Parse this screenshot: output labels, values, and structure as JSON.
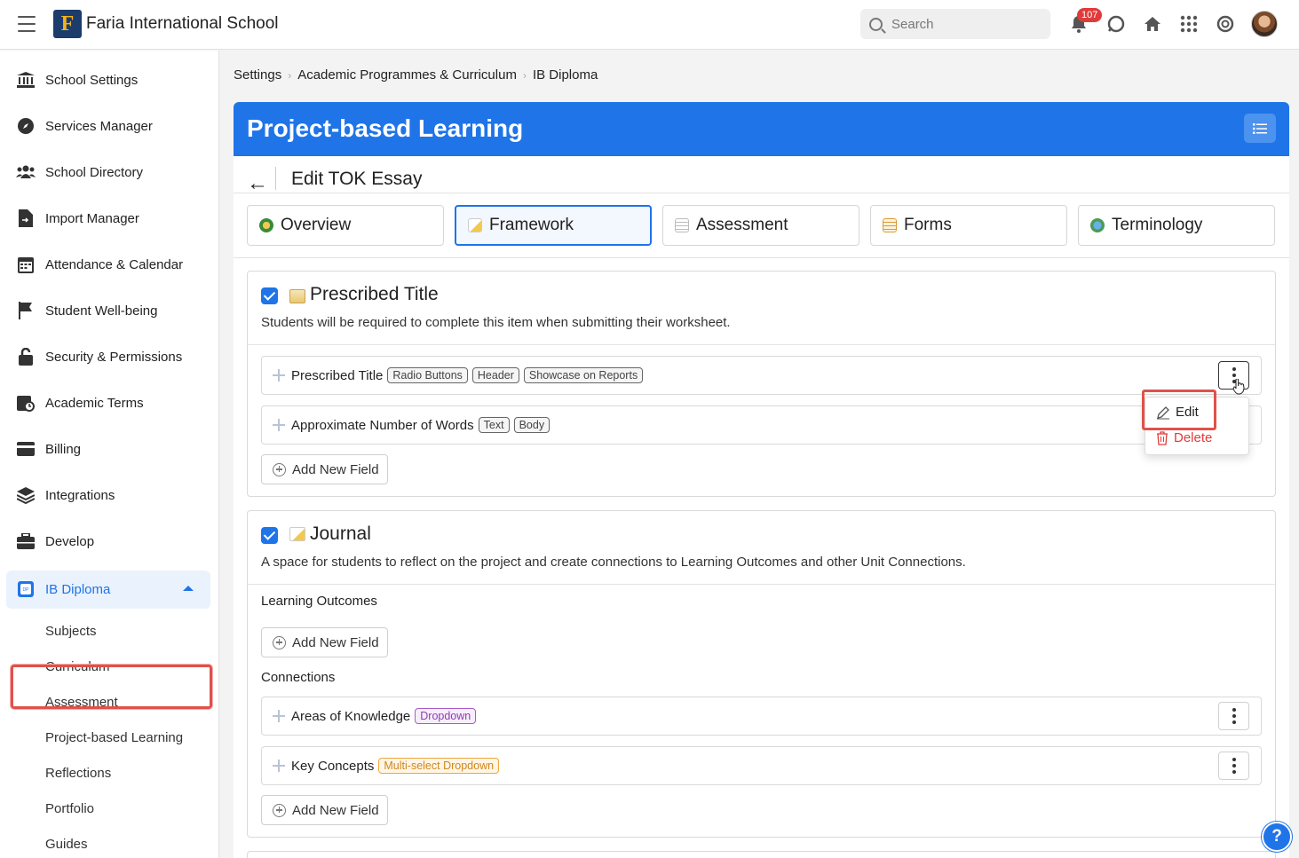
{
  "topbar": {
    "school_name": "Faria International School",
    "logo_letter": "F",
    "search_placeholder": "Search",
    "notifications_count": "107"
  },
  "sidebar": {
    "items": [
      {
        "label": "School Settings",
        "icon": "bank-icon"
      },
      {
        "label": "Services Manager",
        "icon": "compass-icon"
      },
      {
        "label": "School Directory",
        "icon": "users-icon"
      },
      {
        "label": "Import Manager",
        "icon": "file-import-icon"
      },
      {
        "label": "Attendance & Calendar",
        "icon": "calendar-icon"
      },
      {
        "label": "Student Well-being",
        "icon": "flag-icon"
      },
      {
        "label": "Security & Permissions",
        "icon": "lock-icon"
      },
      {
        "label": "Academic Terms",
        "icon": "calendar-clock-icon"
      },
      {
        "label": "Billing",
        "icon": "credit-card-icon"
      },
      {
        "label": "Integrations",
        "icon": "layers-icon"
      },
      {
        "label": "Develop",
        "icon": "briefcase-icon"
      }
    ],
    "active_group": "IB Diploma",
    "sub_items": [
      "Subjects",
      "Curriculum",
      "Assessment",
      "Project-based Learning",
      "Reflections",
      "Portfolio",
      "Guides"
    ],
    "selected_sub_item": "Project-based Learning"
  },
  "breadcrumb": [
    "Settings",
    "Academic Programmes & Curriculum",
    "IB Diploma"
  ],
  "page": {
    "banner_title": "Project-based Learning",
    "edit_title": "Edit TOK Essay"
  },
  "tabs": [
    "Overview",
    "Framework",
    "Assessment",
    "Forms",
    "Terminology"
  ],
  "active_tab": "Framework",
  "sections": {
    "prescribed": {
      "title": "Prescribed Title",
      "description": "Students will be required to complete this item when submitting their worksheet.",
      "fields": [
        {
          "label": "Prescribed Title",
          "tags": [
            "Radio Buttons",
            "Header",
            "Showcase on Reports"
          ]
        },
        {
          "label": "Approximate Number of Words",
          "tags": [
            "Text",
            "Body"
          ]
        }
      ],
      "add_label": "Add New Field"
    },
    "journal": {
      "title": "Journal",
      "description": "A space for students to reflect on the project and create connections to Learning Outcomes and other Unit Connections.",
      "learning_outcomes_label": "Learning Outcomes",
      "connections_label": "Connections",
      "fields": [
        {
          "label": "Areas of Knowledge",
          "tags": [
            "Dropdown"
          ]
        },
        {
          "label": "Key Concepts",
          "tags": [
            "Multi-select Dropdown"
          ]
        }
      ],
      "add_label": "Add New Field"
    }
  },
  "context_menu": {
    "edit": "Edit",
    "delete": "Delete"
  },
  "colors": {
    "primary": "#1f74e8",
    "highlight": "#e0514b",
    "delete": "#e03b3b"
  },
  "help_label": "?"
}
